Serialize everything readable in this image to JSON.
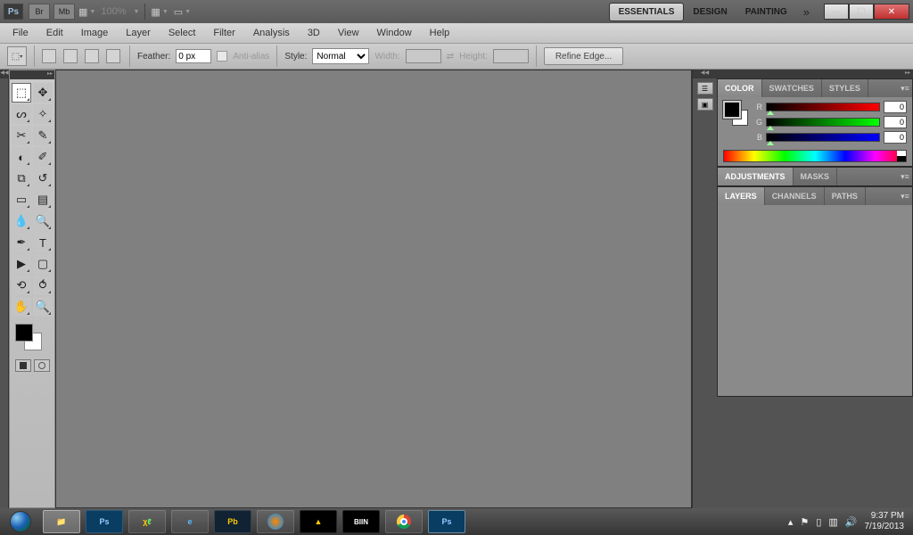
{
  "app_bar": {
    "logo_text": "Ps",
    "btn_br": "Br",
    "btn_mb": "Mb",
    "zoom": "100%",
    "workspaces": {
      "essentials": "ESSENTIALS",
      "design": "DESIGN",
      "painting": "PAINTING"
    }
  },
  "menu": {
    "file": "File",
    "edit": "Edit",
    "image": "Image",
    "layer": "Layer",
    "select": "Select",
    "filter": "Filter",
    "analysis": "Analysis",
    "three_d": "3D",
    "view": "View",
    "window": "Window",
    "help": "Help"
  },
  "options": {
    "feather_label": "Feather:",
    "feather_value": "0 px",
    "antialias_label": "Anti-alias",
    "style_label": "Style:",
    "style_value": "Normal",
    "width_label": "Width:",
    "height_label": "Height:",
    "refine_edge": "Refine Edge..."
  },
  "tools": [
    [
      "marquee",
      "move"
    ],
    [
      "lasso",
      "quick-select"
    ],
    [
      "crop",
      "eyedropper"
    ],
    [
      "spot-heal",
      "brush"
    ],
    [
      "clone",
      "history-brush"
    ],
    [
      "eraser",
      "gradient"
    ],
    [
      "blur",
      "dodge"
    ],
    [
      "pen",
      "type"
    ],
    [
      "path-select",
      "rectangle"
    ],
    [
      "3d-rotate",
      "3d-orbit"
    ],
    [
      "hand",
      "zoom"
    ]
  ],
  "tool_glyphs": {
    "marquee": "⬚",
    "move": "✥",
    "lasso": "ᔕ",
    "quick-select": "✧",
    "crop": "✂",
    "eyedropper": "✎",
    "spot-heal": "◐",
    "brush": "✐",
    "clone": "⧉",
    "history-brush": "↺",
    "eraser": "▭",
    "gradient": "▤",
    "blur": "💧",
    "dodge": "🔍",
    "pen": "✒",
    "type": "T",
    "path-select": "▶",
    "rectangle": "▢",
    "3d-rotate": "⟲",
    "3d-orbit": "⥀",
    "hand": "✋",
    "zoom": "🔍"
  },
  "swatches": {
    "fg": "#000000",
    "bg": "#ffffff"
  },
  "panels": {
    "color": {
      "tab": "COLOR",
      "swatches_tab": "SWATCHES",
      "styles_tab": "STYLES",
      "r_label": "R",
      "g_label": "G",
      "b_label": "B",
      "r": "0",
      "g": "0",
      "b": "0"
    },
    "adjustments": {
      "tab": "ADJUSTMENTS",
      "masks_tab": "MASKS"
    },
    "layers": {
      "tab": "LAYERS",
      "channels_tab": "CHANNELS",
      "paths_tab": "PATHS"
    }
  },
  "taskbar": {
    "items": [
      "explorer",
      "Ps",
      "xl",
      "ie",
      "Pb",
      "wmp",
      "aimp",
      "BIIN",
      "chrome",
      "Ps2"
    ],
    "tray": {
      "up": "▴",
      "flag": "⚑",
      "bat": "▯",
      "net": "▥",
      "vol": "🔊"
    },
    "time": "9:37 PM",
    "date": "7/19/2013"
  }
}
